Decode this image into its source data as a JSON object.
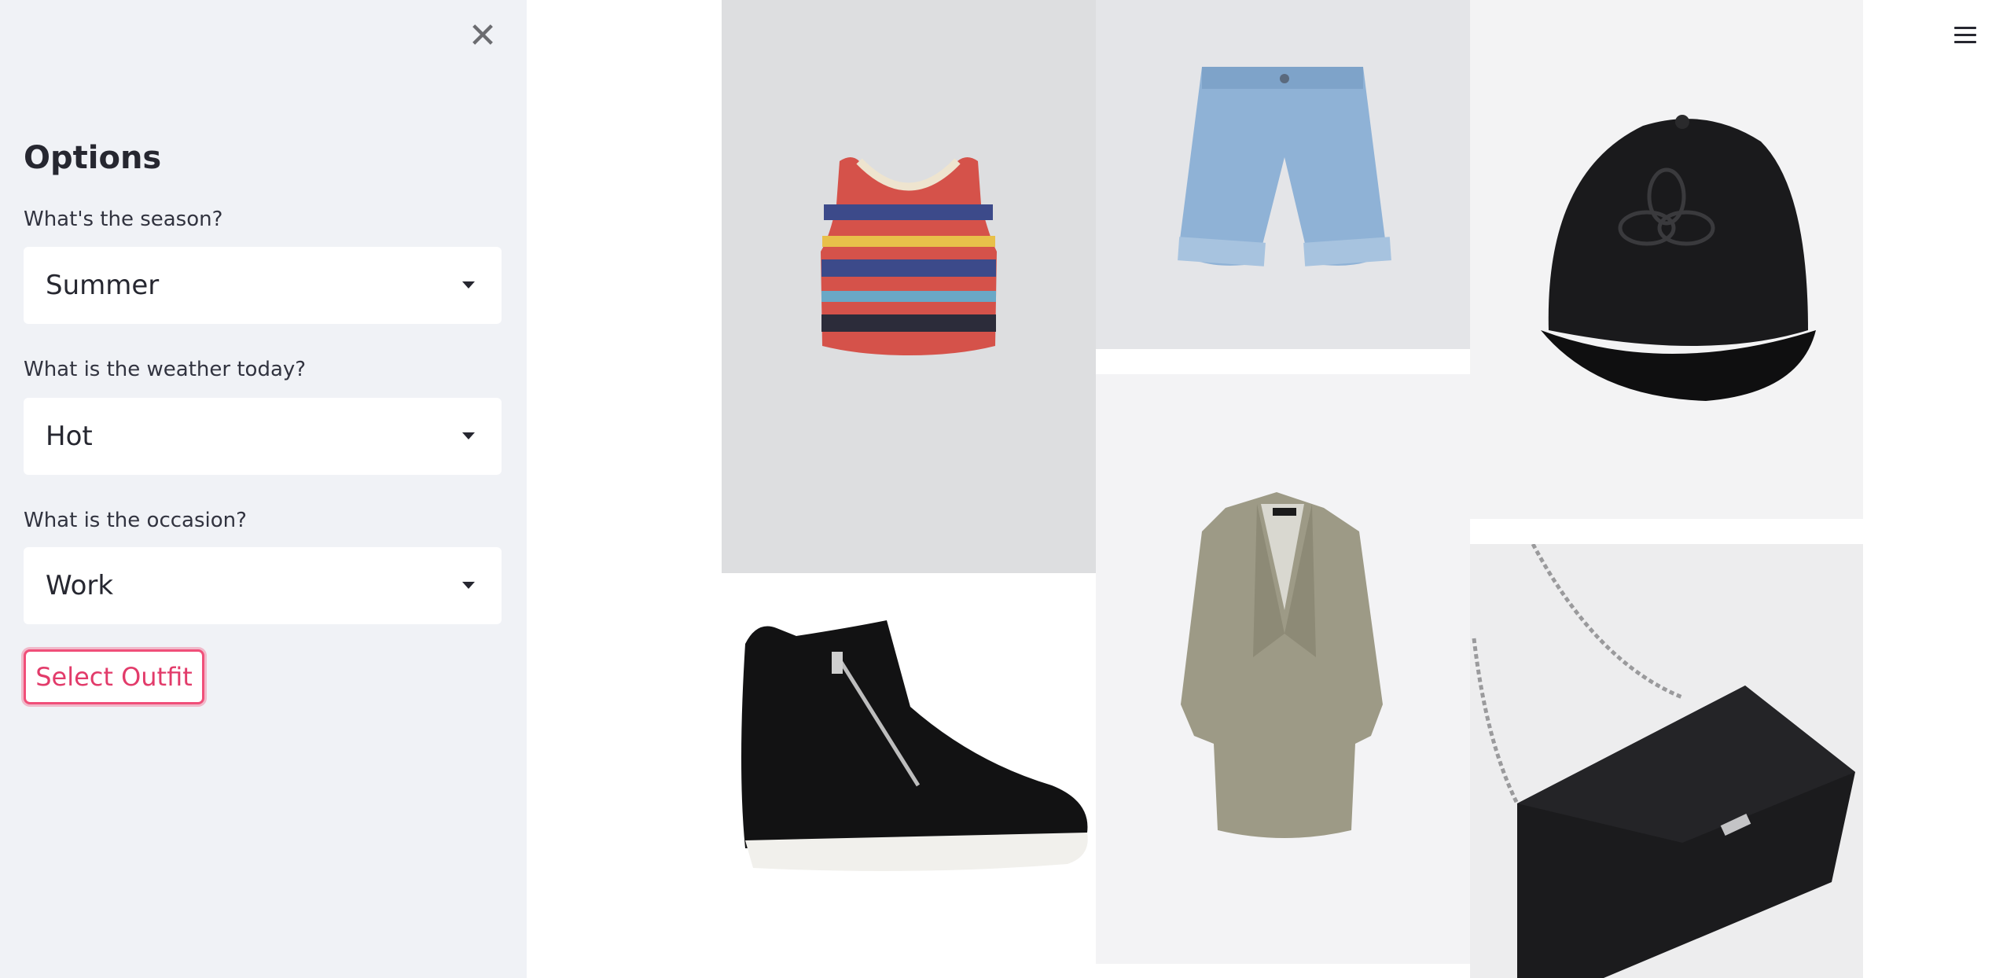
{
  "sidebar": {
    "close_icon": "close-icon",
    "title": "Options",
    "fields": [
      {
        "label": "What's the season?",
        "value": "Summer"
      },
      {
        "label": "What is the weather today?",
        "value": "Hot"
      },
      {
        "label": "What is the occasion?",
        "value": "Work"
      }
    ],
    "button_label": "Select Outfit"
  },
  "header": {
    "menu_icon": "hamburger-menu-icon"
  },
  "outfit_images": [
    {
      "name": "sleeveless-knit-top-image"
    },
    {
      "name": "denim-shorts-image"
    },
    {
      "name": "black-baseball-cap-image"
    },
    {
      "name": "black-wedge-sneaker-image"
    },
    {
      "name": "khaki-blazer-image"
    },
    {
      "name": "black-crossbody-bag-image"
    }
  ],
  "colors": {
    "accent": "#f04f79",
    "sidebar_bg": "#f0f2f6"
  }
}
